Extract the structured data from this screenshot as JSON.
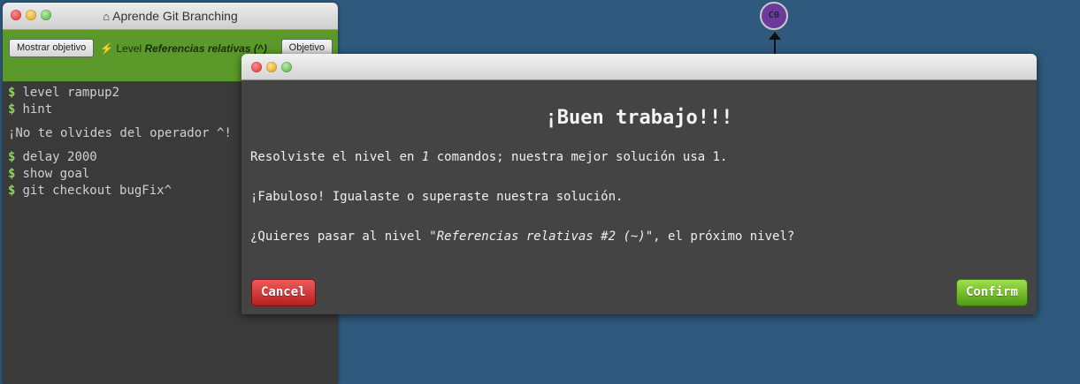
{
  "window": {
    "title": "Aprende Git Branching",
    "home_icon": "home-icon"
  },
  "level_bar": {
    "goal_button": "Mostrar objetivo",
    "objective_button": "Objetivo",
    "level_prefix": "Level ",
    "level_name": "Referencias relativas (^)",
    "level_icon": "bolt-icon"
  },
  "terminal": {
    "prompt": "$",
    "lines": [
      "level rampup2",
      "hint"
    ],
    "hint_text": "¡No te olvides del operador ^!",
    "lines2": [
      "delay 2000",
      "show goal",
      "git checkout bugFix^"
    ]
  },
  "canvas": {
    "node_label": "C0"
  },
  "modal": {
    "heading": "¡Buen trabajo!!!",
    "p1_a": "Resolviste el nivel en ",
    "p1_num": "1",
    "p1_b": " comandos; nuestra mejor solución usa 1.",
    "p2": "¡Fabuloso! Igualaste o superaste nuestra solución.",
    "p3_a": "¿Quieres pasar al nivel ",
    "p3_level": "\"Referencias relativas #2 (~)\"",
    "p3_b": ", el próximo nivel?",
    "cancel_label": "Cancel",
    "confirm_label": "Confirm"
  },
  "colors": {
    "background": "#2f5a7d",
    "level_bar": "#5b9a2a",
    "prompt": "#8fd35a",
    "cancel": "#c62b2b",
    "confirm": "#6bb726",
    "node": "#6c3a9a"
  }
}
